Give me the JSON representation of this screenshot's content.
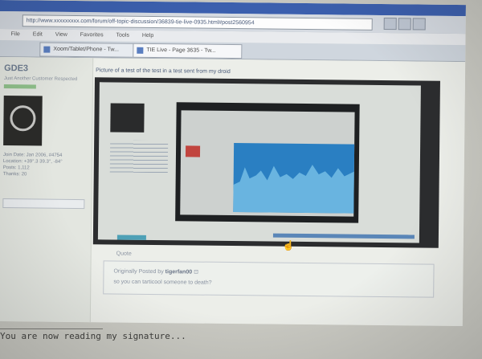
{
  "browser": {
    "address": "http://www.xxxxxxxxx.com/forum/off-topic-discussion/36839-tie-live-0935.html#post2560954",
    "menu": [
      "File",
      "Edit",
      "View",
      "Favorites",
      "Tools",
      "Help"
    ],
    "tabs": [
      {
        "label": "Xoom/Tablet/Phone - Tw..."
      },
      {
        "label": "TIE Live - Page 3635 - Tw..."
      }
    ]
  },
  "profile": {
    "name": "GDE3",
    "rank": "Just Another Customer Respected",
    "info": [
      "Join Date: Jan 2006, #4754",
      "Location: +39°.3 39.3°, -84°",
      "Posts: 1,112",
      "Thanks: 20"
    ]
  },
  "post": {
    "title": "Picture of a test of the test in a test sent from my droid",
    "quote_label": "Quote",
    "quote_prefix": "Originally Posted by",
    "quote_user": "tigerfan00",
    "quote_text": "so you can tarticool someone to death?"
  },
  "signature": "You are now reading my signature..."
}
